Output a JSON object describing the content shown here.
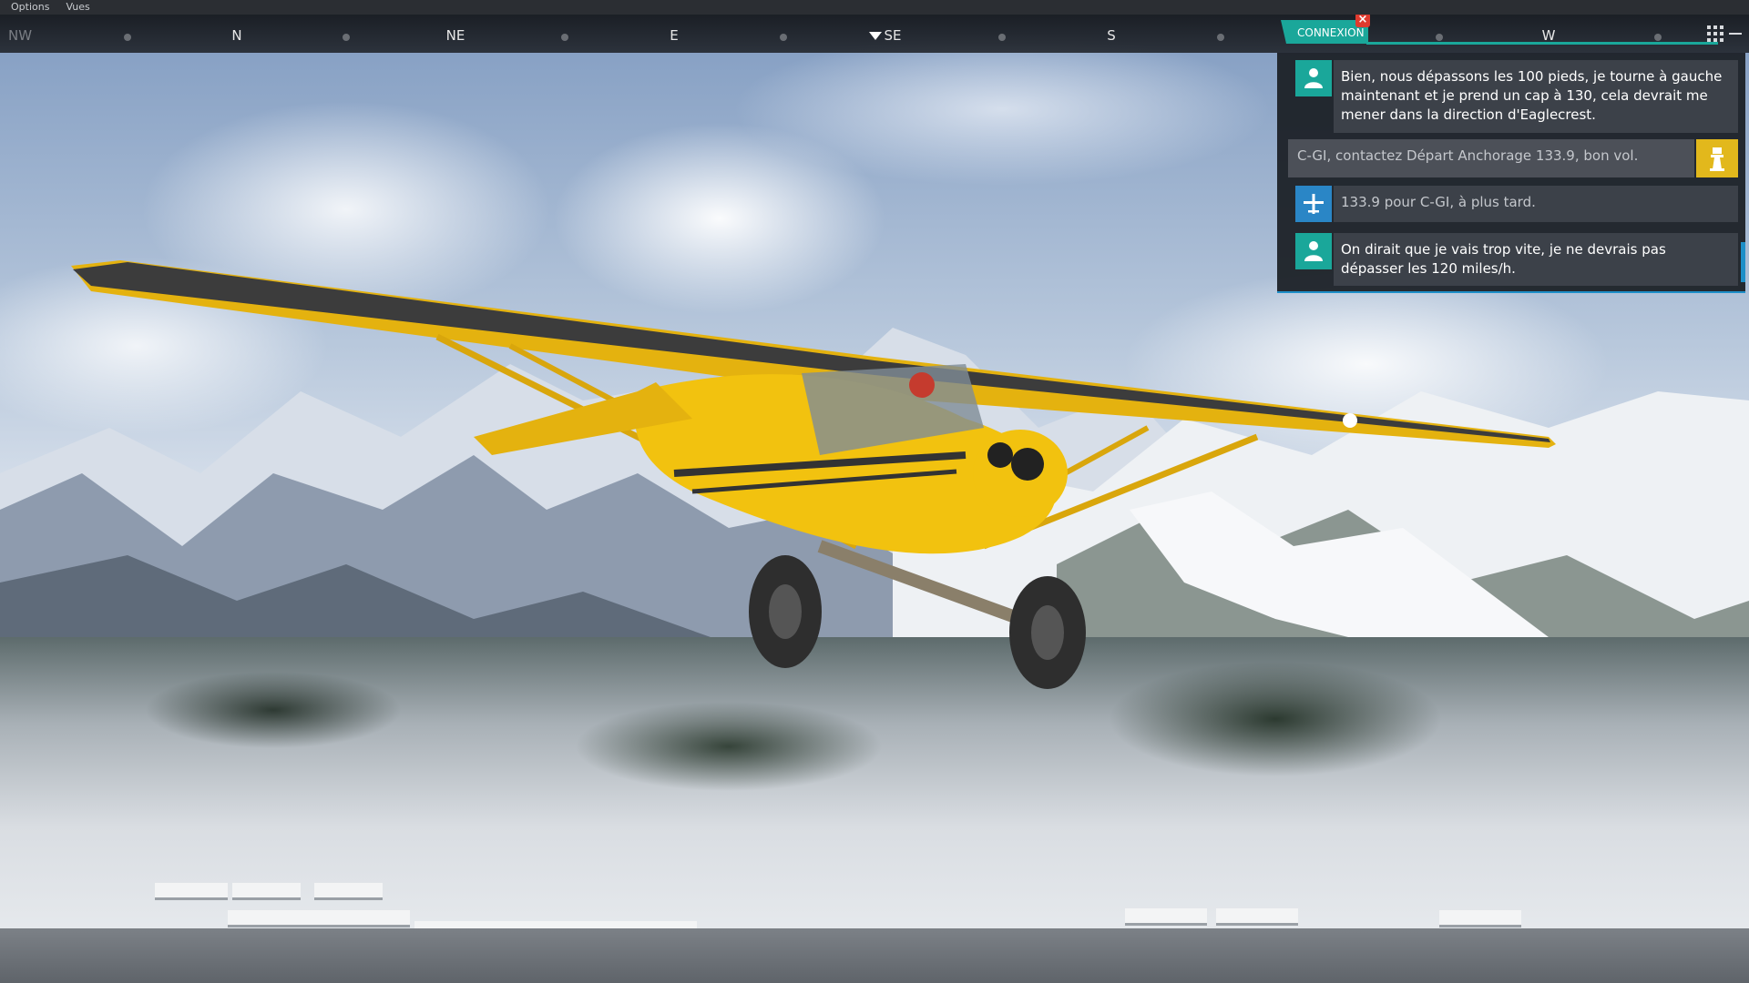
{
  "menu": {
    "items": [
      "Options",
      "Vues"
    ]
  },
  "compass": {
    "labels": [
      "NW",
      "N",
      "NE",
      "E",
      "SE",
      "S",
      "W"
    ],
    "heading_marker": "down-triangle-icon"
  },
  "atc": {
    "tab_label": "CONNEXION",
    "close_icon": "close-icon",
    "accent_color": "#1aa79a",
    "messages": [
      {
        "type": "pilot",
        "icon": "person-icon",
        "text": "Bien, nous dépassons les 100 pieds, je tourne à gauche maintenant et je prend un cap à 130, cela devrait me mener dans la direction d'Eaglecrest."
      },
      {
        "type": "atc",
        "icon": "control-tower-icon",
        "text": "C-GI, contactez Départ Anchorage 133.9, bon vol."
      },
      {
        "type": "plane",
        "icon": "airplane-icon",
        "text": "133.9 pour C-GI, à plus tard."
      },
      {
        "type": "pilot",
        "icon": "person-icon",
        "text": "On dirait que je vais trop vite, je ne devrais pas dépasser les 120 miles/h."
      }
    ]
  },
  "toolbar": {
    "grid_icon": "grid-icon",
    "minimize_icon": "minimize-icon"
  }
}
